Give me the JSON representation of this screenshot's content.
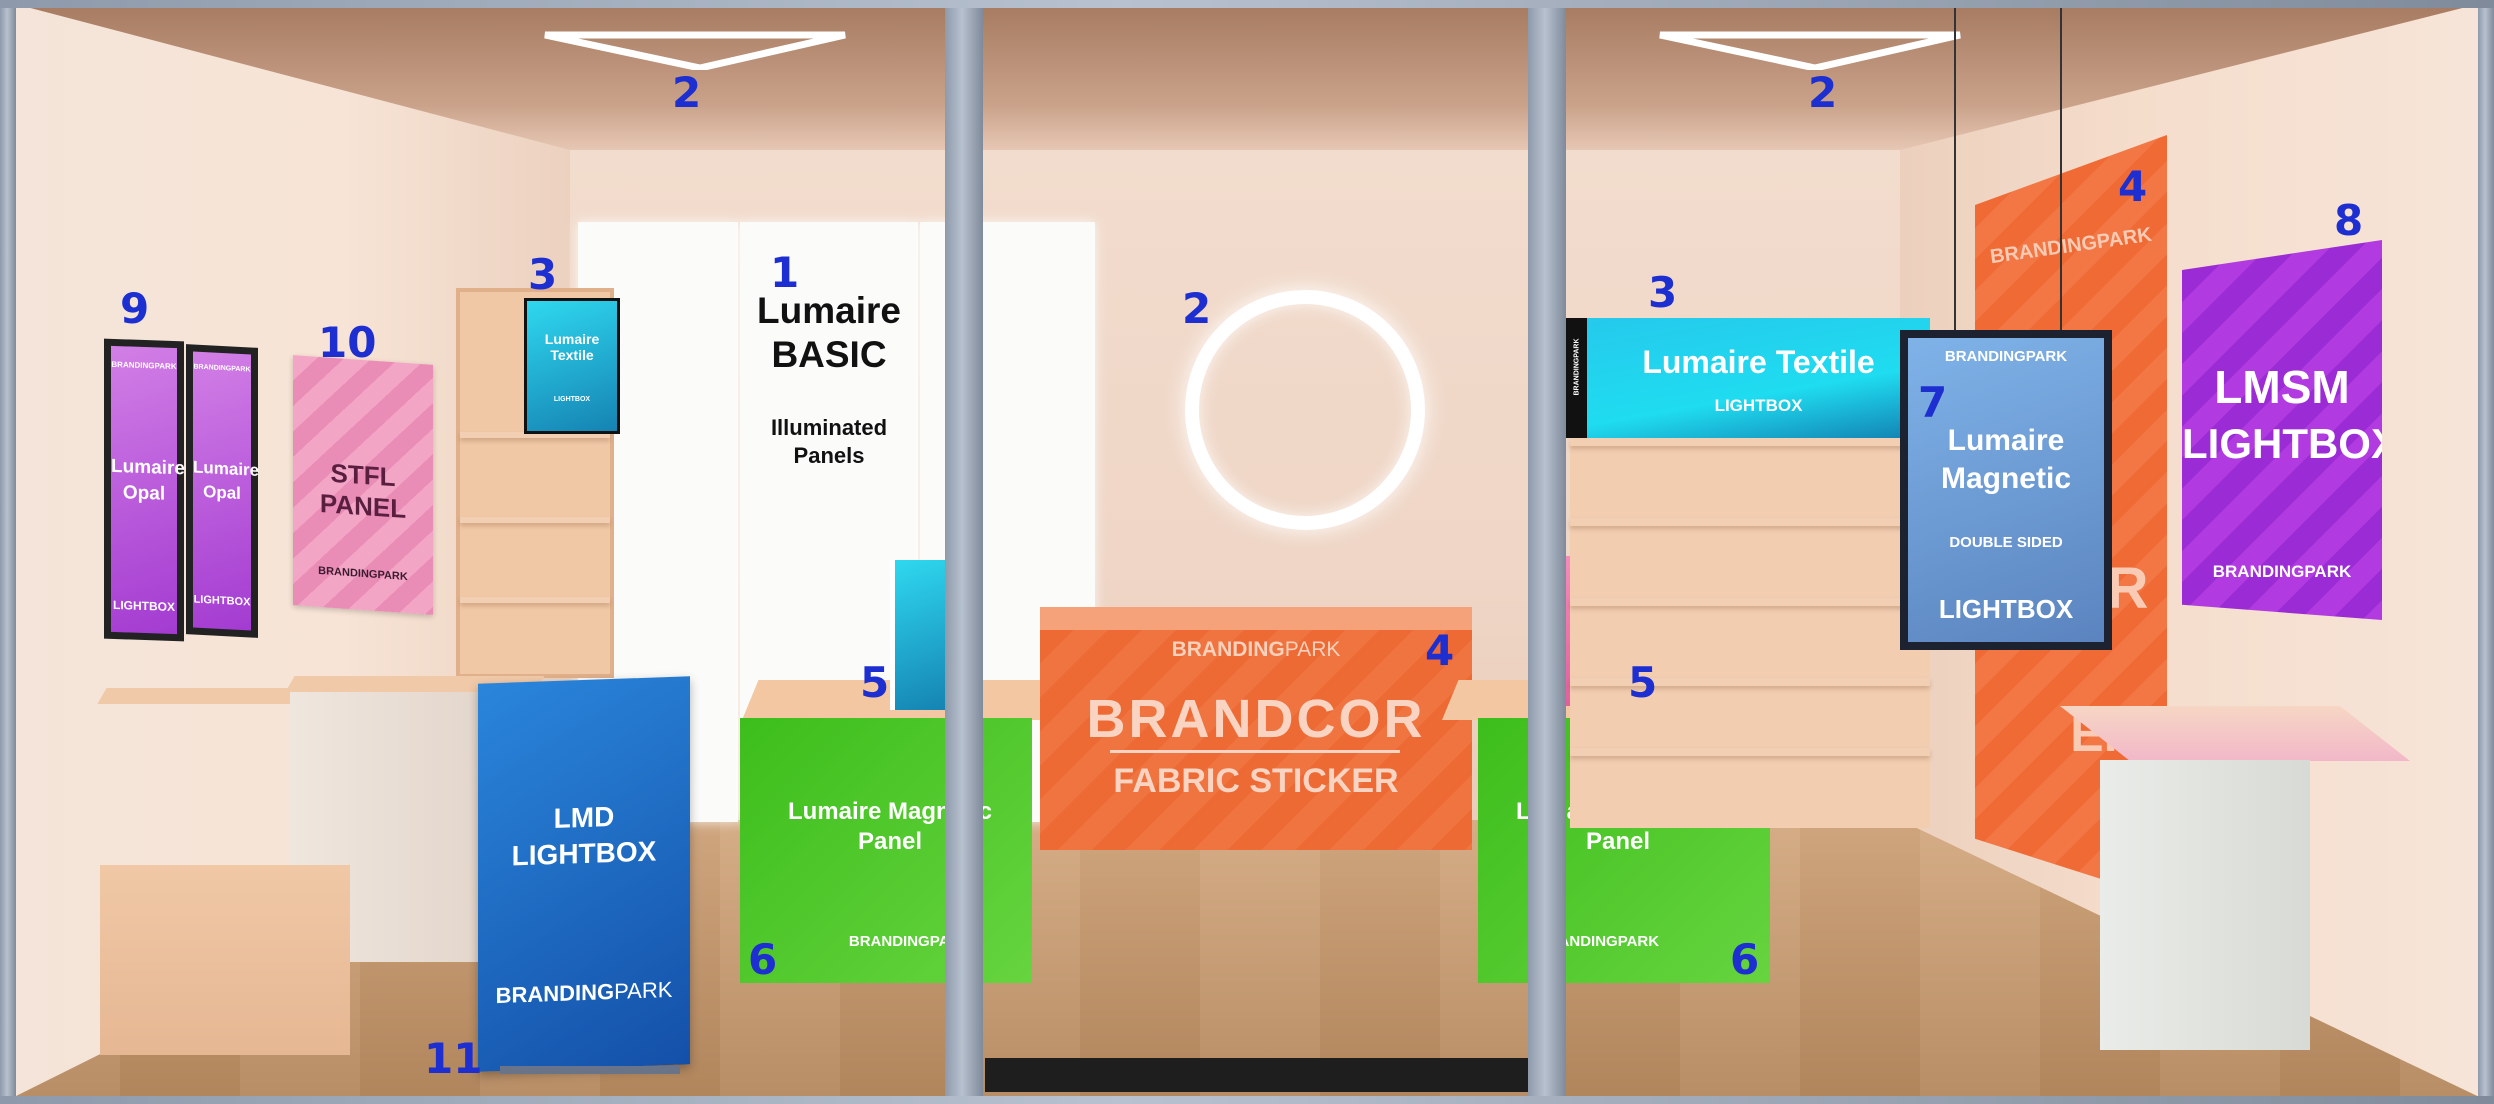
{
  "labels": {
    "l1": "1",
    "l2a": "2",
    "l2b": "2",
    "l2c": "2",
    "l3a": "3",
    "l3b": "3",
    "l4a": "4",
    "l4b": "4",
    "l5a": "5",
    "l5b": "5",
    "l6a": "6",
    "l6b": "6",
    "l7": "7",
    "l8": "8",
    "l9": "9",
    "l10": "10",
    "l11": "11"
  },
  "basic_panel": {
    "line1": "Lumaire",
    "line2": "BASIC",
    "sub1": "Illuminated",
    "sub2": "Panels"
  },
  "opal_frame": {
    "brand": "BRANDINGPARK",
    "l1": "Lumaire",
    "l2": "Opal",
    "foot": "LIGHTBOX"
  },
  "stfl": {
    "title": "STFL PANEL",
    "brand": "BRANDINGPARK"
  },
  "textile_small": {
    "title": "Lumaire Textile",
    "sub": "LIGHTBOX"
  },
  "textile_big": {
    "brand": "BRANDINGPARK",
    "title": "Lumaire Textile",
    "sub": "LIGHTBOX"
  },
  "lmd": {
    "l1": "LMD",
    "l2": "LIGHTBOX",
    "brand_a": "BRANDING",
    "brand_b": "PARK"
  },
  "magnetic_panel": {
    "l1": "Lumaire Magnetic",
    "l2": "Panel",
    "brand": "BRANDINGPARK"
  },
  "brandcor": {
    "brand_a": "BRANDING",
    "brand_b": "PARK",
    "title": "BRANDCOR",
    "sub": "FABRIC STICKER"
  },
  "hanging": {
    "brand": "BRANDINGPARK",
    "l1": "Lumaire",
    "l2": "Magnetic",
    "sub": "DOUBLE SIDED",
    "foot": "LIGHTBOX"
  },
  "orange_wall": {
    "brand": "BRANDINGPARK",
    "partial": "OR",
    "partial2": "ER"
  },
  "lmsm": {
    "l1": "LMSM",
    "l2": "LIGHTBOX",
    "brand": "BRANDINGPARK"
  },
  "colors": {
    "label_blue": "#1d2fd0",
    "green": "#3fbf1e",
    "orange": "#ee6a35",
    "cyan": "#1fd0ec",
    "purple": "#9f34e0",
    "blue": "#1c68c9"
  }
}
